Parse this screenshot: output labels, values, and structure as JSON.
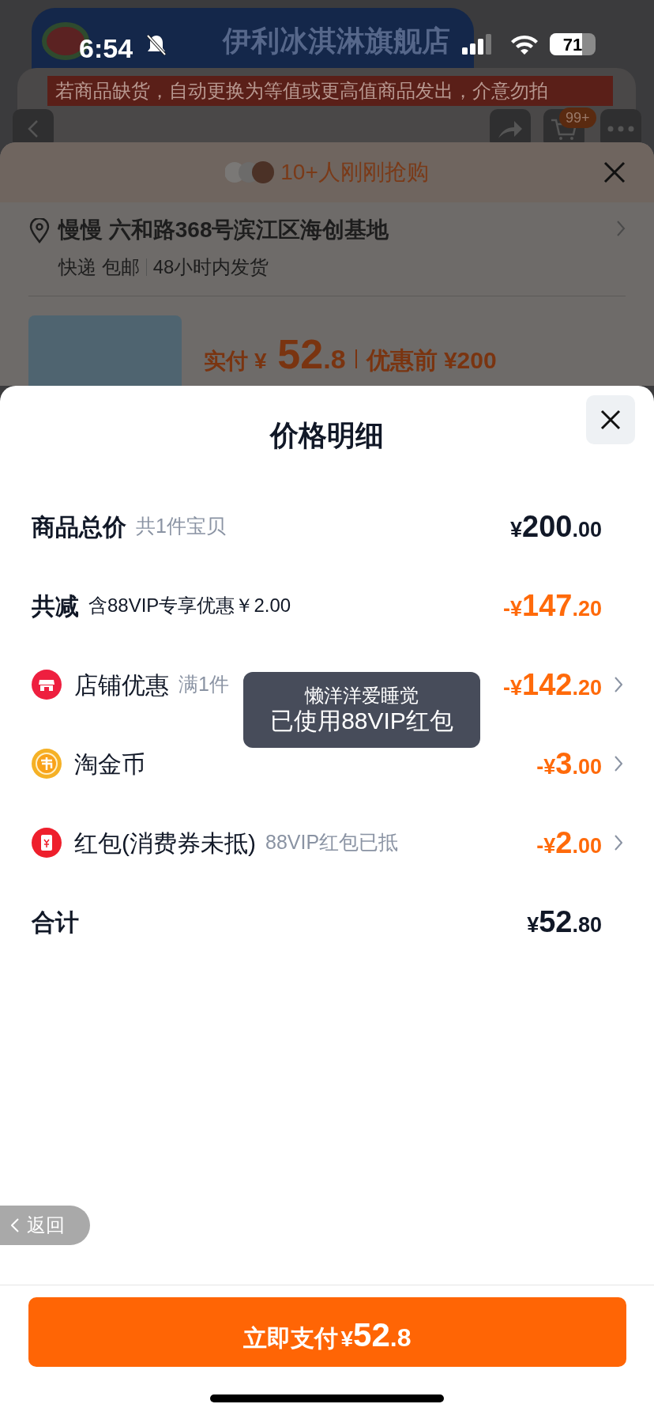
{
  "status_bar": {
    "time": "6:54",
    "battery": "71"
  },
  "store_header": {
    "title": "伊利冰淇淋旗舰店",
    "notice": "若商品缺货，自动更换为等值或更高值商品发出，介意勿拍",
    "cart_badge": "99+"
  },
  "purchase_sheet": {
    "buyers_text": "10+人刚刚抢购",
    "address": "慢慢 六和路368号滨江区海创基地",
    "shipping": [
      "快递 包邮",
      "48小时内发货"
    ],
    "price_label": "实付",
    "price": "¥ 52.8",
    "original_price": "优惠前 ¥200"
  },
  "price_sheet": {
    "title": "价格明细",
    "rows": [
      {
        "kind": "subtotal",
        "label": "商品总价",
        "note": "共1件宝贝",
        "amount": "¥200.00",
        "chevron": false
      },
      {
        "kind": "reduction",
        "label": "共减",
        "note": "含88VIP专享优惠￥2.00",
        "amount": "-¥147.20",
        "chevron": false
      },
      {
        "kind": "shop",
        "label": "店铺优惠",
        "note": "满1件",
        "amount": "-¥142.20",
        "chevron": true
      },
      {
        "kind": "coin",
        "label": "淘金币",
        "amount": "-¥3.00",
        "chevron": true
      },
      {
        "kind": "envelope",
        "label": "红包(消费券未抵)",
        "note": "88VIP红包已抵",
        "amount": "-¥2.00",
        "chevron": true
      },
      {
        "kind": "total",
        "label": "合计",
        "amount": "¥52.80",
        "chevron": false
      }
    ]
  },
  "toast": [
    "懒洋洋爱睡觉",
    "已使用88VIP红包"
  ],
  "back_button": "返回",
  "pay_button": {
    "label": "立即支付",
    "amount": "¥52.8"
  }
}
